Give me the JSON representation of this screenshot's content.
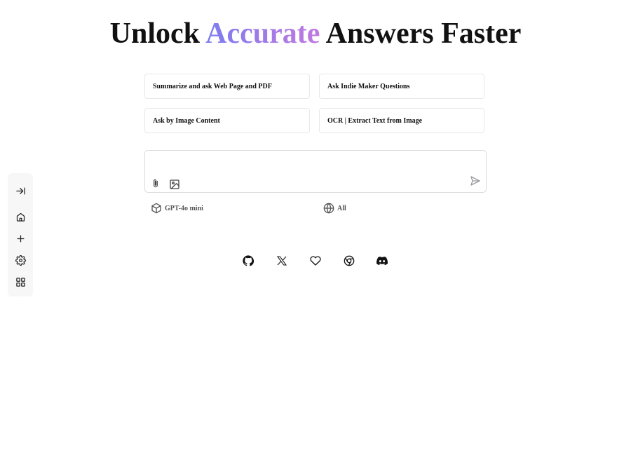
{
  "title": {
    "prefix": "Unlock ",
    "accent": "Accurate",
    "suffix": " Answers Faster",
    "accent_gradient": [
      "#7b7cf0",
      "#c079e0"
    ]
  },
  "suggestions": [
    {
      "label": "Summarize and ask Web Page and PDF"
    },
    {
      "label": "Ask Indie Maker Questions"
    },
    {
      "label": "Ask by Image Content"
    },
    {
      "label": "OCR | Extract Text from Image"
    }
  ],
  "input": {
    "value": "",
    "placeholder": "",
    "attach_icon": "paperclip-icon",
    "image_icon": "image-icon",
    "send_icon": "send-icon"
  },
  "model_selector": {
    "label": "GPT-4o mini",
    "icon": "cube-icon"
  },
  "source_selector": {
    "label": "All",
    "icon": "globe-icon"
  },
  "rail": {
    "items": [
      {
        "icon": "expand-sidebar-icon"
      },
      {
        "icon": "home-icon"
      },
      {
        "icon": "plus-icon"
      },
      {
        "icon": "gear-icon"
      },
      {
        "icon": "apps-grid-icon"
      }
    ],
    "background": "#f7f7f8"
  },
  "social": [
    {
      "icon": "github-icon"
    },
    {
      "icon": "x-twitter-icon"
    },
    {
      "icon": "heart-icon"
    },
    {
      "icon": "chrome-icon"
    },
    {
      "icon": "discord-icon"
    }
  ]
}
